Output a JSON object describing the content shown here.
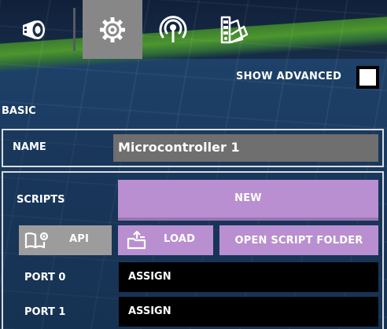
{
  "toolbar": {
    "tabs": [
      {
        "icon": "wheel-icon",
        "active": false
      },
      {
        "icon": "gear-icon",
        "active": true
      },
      {
        "icon": "antenna-icon",
        "active": false
      },
      {
        "icon": "color-palette-icon",
        "active": false
      }
    ],
    "active_color": "#878787"
  },
  "advanced": {
    "label": "SHOW ADVANCED",
    "checked": false
  },
  "basic": {
    "section_label": "BASIC",
    "name_label": "NAME",
    "name_value": "Microcontroller 1"
  },
  "scripts": {
    "label": "SCRIPTS",
    "new_label": "NEW",
    "api_label": "API",
    "load_label": "LOAD",
    "open_folder_label": "OPEN SCRIPT FOLDER",
    "accent": "#b98fd1"
  },
  "ports": [
    {
      "label": "PORT 0",
      "value": "ASSIGN"
    },
    {
      "label": "PORT 1",
      "value": "ASSIGN"
    }
  ]
}
